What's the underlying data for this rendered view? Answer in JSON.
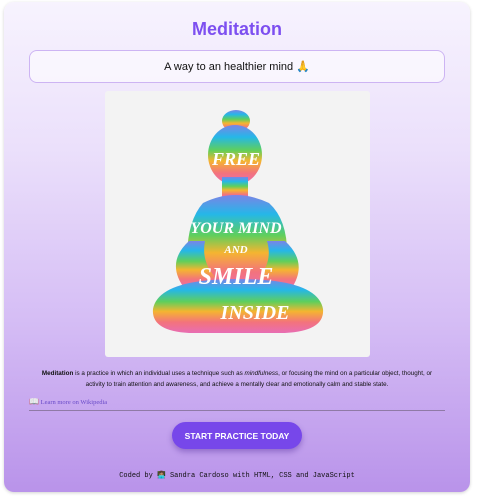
{
  "app": {
    "title": "Meditation",
    "tagline": "A way to an healthier mind 🙏"
  },
  "artwork": {
    "words": [
      "FREE",
      "YOUR MIND",
      "AND",
      "SMILE",
      "INSIDE"
    ],
    "gradient": [
      "#6f8ee8",
      "#27b6e6",
      "#62cf5e",
      "#f4b232",
      "#f36f7e",
      "#e96fb0"
    ]
  },
  "description": {
    "term": "Meditation",
    "part1": " is a practice in which an individual uses a technique such as ",
    "emph": "mindfulness",
    "part2": ", or focusing the mind on a particular object, thought, or activity to train attention and awareness, and achieve a mentally clear and emotionally calm and stable state."
  },
  "wiki": {
    "icon": "📖",
    "label": "Learn more on Wikipedia"
  },
  "cta": {
    "label": "START PRACTICE TODAY",
    "color": "#7747ea"
  },
  "footer": {
    "text": "Coded by 👩🏽‍💻 Sandra Cardoso with HTML, CSS and JavaScript"
  }
}
